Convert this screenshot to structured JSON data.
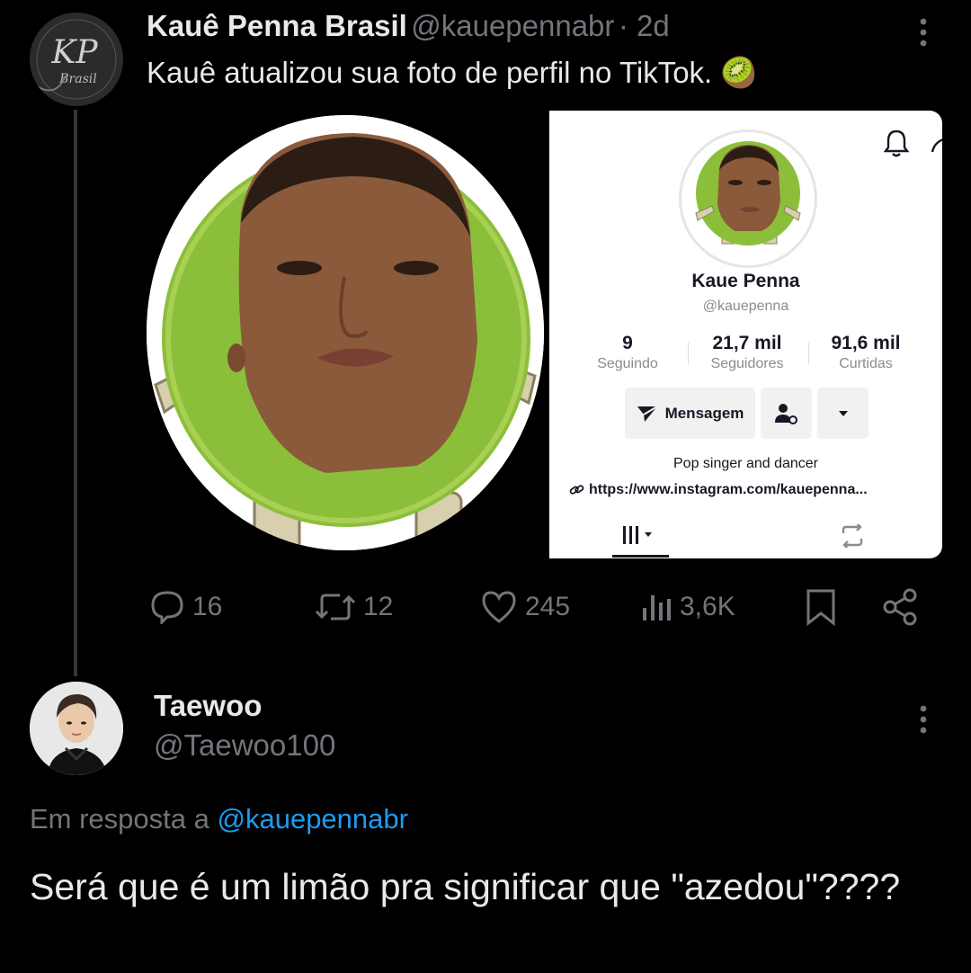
{
  "tweet": {
    "author_name": "Kauê Penna Brasil",
    "author_handle": "@kauepennabr",
    "time": "· 2d",
    "text": "Kauê atualizou sua foto de perfil no TikTok. 🥝",
    "avatar_text": "KP",
    "avatar_subtext": "Brasil",
    "actions": {
      "replies": "16",
      "retweets": "12",
      "likes": "245",
      "views": "3,6K"
    }
  },
  "tiktok_profile": {
    "name": "Kaue Penna",
    "handle": "@kauepenna",
    "stats": [
      {
        "value": "9",
        "label": "Seguindo"
      },
      {
        "value": "21,7 mil",
        "label": "Seguidores"
      },
      {
        "value": "91,6 mil",
        "label": "Curtidas"
      }
    ],
    "message_button": "Mensagem",
    "bio": "Pop singer and dancer",
    "link": "https://www.instagram.com/kauepenna..."
  },
  "reply": {
    "author_name": "Taewoo",
    "author_handle": "@Taewoo100",
    "replying_to_label": "Em resposta a",
    "replying_to_handle": "@kauepennabr",
    "text": "Será que é um limão pra significar que \"azedou\"????"
  },
  "colors": {
    "background": "#000000",
    "text_primary": "#e7e9ea",
    "text_secondary": "#71767b",
    "link": "#1d9bf0",
    "kiwi_green": "#8bbf3a"
  }
}
